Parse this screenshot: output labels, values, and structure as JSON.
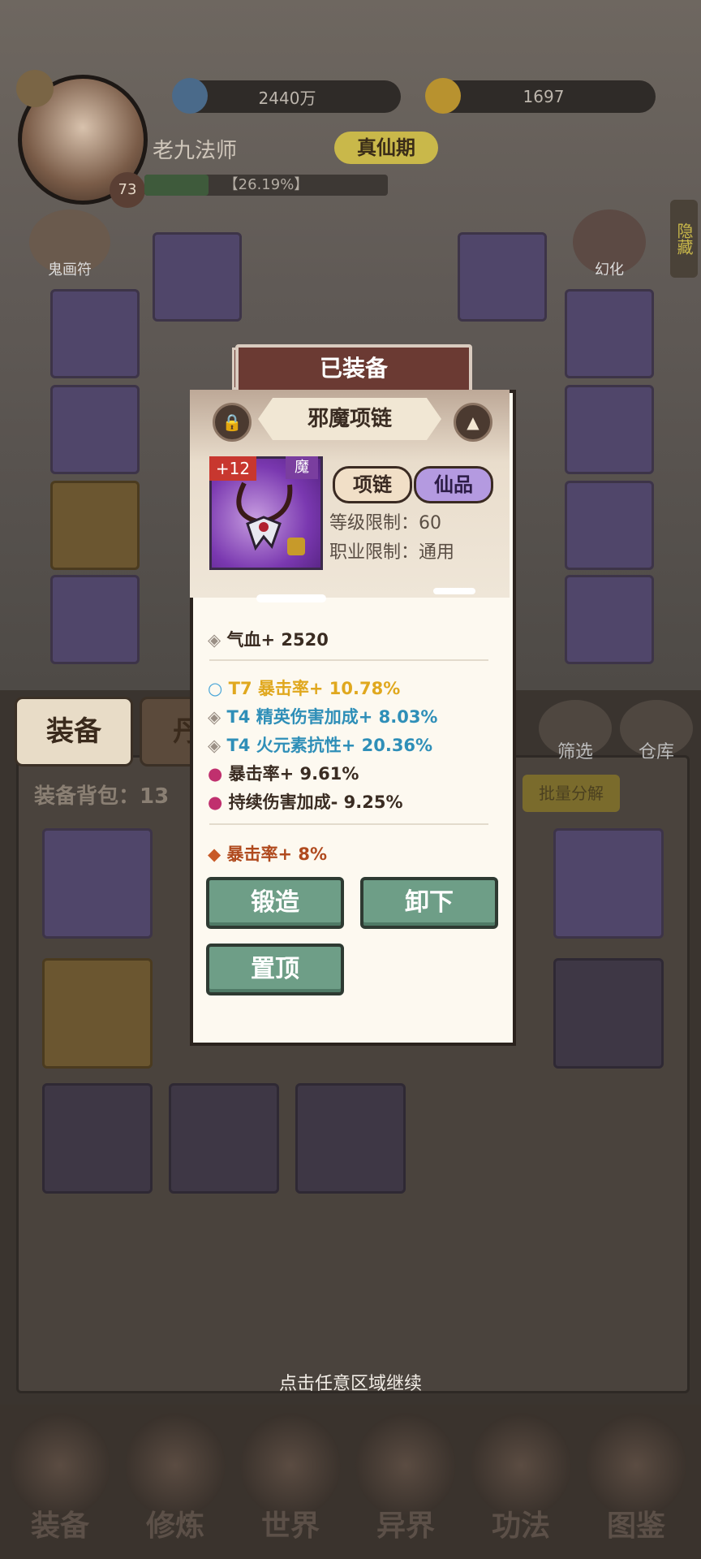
{
  "header": {
    "currency1": "2440万",
    "currency2": "1697",
    "player_name": "老九法师",
    "realm": "真仙期",
    "level": "73",
    "xp_percent": "【26.19%】",
    "talisman_label": "鬼画符",
    "transform_label": "幻化",
    "hide_label": "隐藏"
  },
  "tabs": {
    "equip": "装备",
    "second": "丹",
    "filter": "筛选",
    "warehouse": "仓库"
  },
  "bag": {
    "label": "装备背包：13",
    "batch": "批量分解"
  },
  "dialog": {
    "banner": "已装备",
    "item_name": "邪魔项链",
    "enhance": "+12",
    "mo_badge": "魔",
    "type_tag": "项链",
    "grade_tag": "仙品",
    "level_req": "等级限制：",
    "level_req_value": "60",
    "class_req": "职业限制：",
    "class_req_value": "通用",
    "base_stat": "气血+ 2520",
    "affixes": [
      {
        "text": "T7 暴击率+ 10.78%",
        "color": "#e0a81e",
        "icon": "ring-icon"
      },
      {
        "text": "T4 精英伤害加成+ 8.03%",
        "color": "#2f8fb8",
        "icon": "diamond-icon"
      },
      {
        "text": "T4 火元素抗性+ 20.36%",
        "color": "#2f8fb8",
        "icon": "diamond-icon"
      },
      {
        "text": "暴击率+ 9.61%",
        "color": "#3a2c22",
        "icon": "demon-icon"
      },
      {
        "text": "持续伤害加成- 9.25%",
        "color": "#3a2c22",
        "icon": "demon-icon"
      }
    ],
    "set_stat": "暴击率+ 8%",
    "buttons": {
      "forge": "锻造",
      "unequip": "卸下",
      "pin": "置顶"
    }
  },
  "continue_hint": "点击任意区域继续",
  "bottom_nav": [
    "装备",
    "修炼",
    "世界",
    "异界",
    "功法",
    "图鉴"
  ]
}
